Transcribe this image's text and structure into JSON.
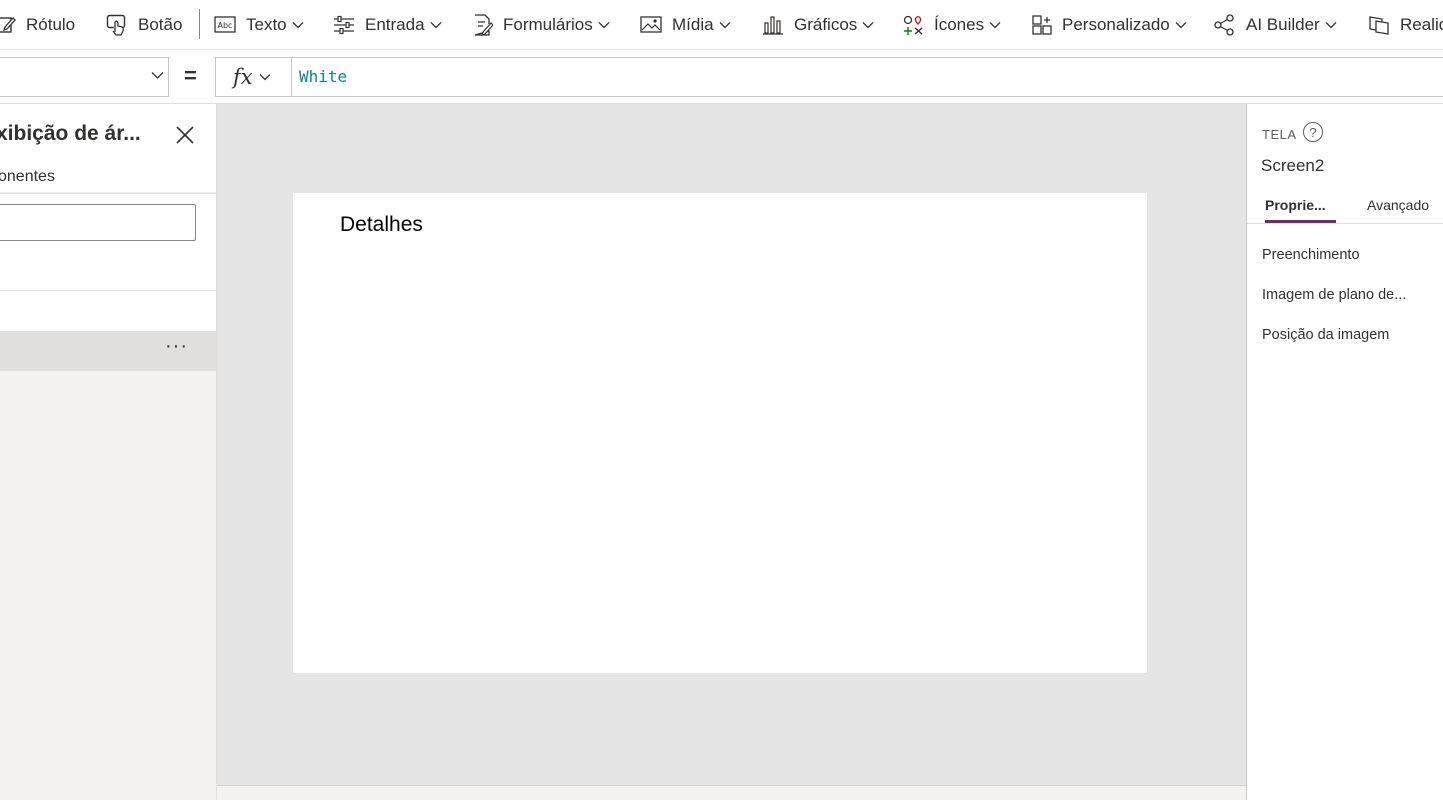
{
  "toolbar": {
    "items": [
      {
        "label": "Rótulo",
        "icon": "edit-label-icon",
        "dropdown": false
      },
      {
        "label": "Botão",
        "icon": "button-touch-icon",
        "dropdown": false
      },
      {
        "label": "Texto",
        "icon": "text-abc-icon",
        "dropdown": true
      },
      {
        "label": "Entrada",
        "icon": "input-sliders-icon",
        "dropdown": true
      },
      {
        "label": "Formulários",
        "icon": "form-edit-icon",
        "dropdown": true
      },
      {
        "label": "Mídia",
        "icon": "media-image-icon",
        "dropdown": true
      },
      {
        "label": "Gráficos",
        "icon": "chart-bar-icon",
        "dropdown": true
      },
      {
        "label": "Ícones",
        "icon": "icons-shapes-icon",
        "dropdown": true
      },
      {
        "label": "Personalizado",
        "icon": "custom-component-icon",
        "dropdown": true
      },
      {
        "label": "AI Builder",
        "icon": "ai-builder-icon",
        "dropdown": true
      },
      {
        "label": "Realid",
        "icon": "mixed-reality-icon",
        "dropdown": false
      }
    ]
  },
  "formula_bar": {
    "property_value": "",
    "equals": "=",
    "fx_label": "fx",
    "formula": "White"
  },
  "left_panel": {
    "title": "xibição de ár...",
    "subtitle": "onentes",
    "search_value": "",
    "more_label": "···"
  },
  "canvas": {
    "screen_label": "Detalhes"
  },
  "right_panel": {
    "kind": "TELA",
    "help": "?",
    "name": "Screen2",
    "tabs": [
      "Proprie...",
      "Avançado"
    ],
    "properties": [
      "Preenchimento",
      "Imagem de plano de...",
      "Posição da imagem"
    ]
  },
  "colors": {
    "accent": "#742774",
    "formula_text": "#098684",
    "canvas_bg": "#e5e5e5"
  }
}
